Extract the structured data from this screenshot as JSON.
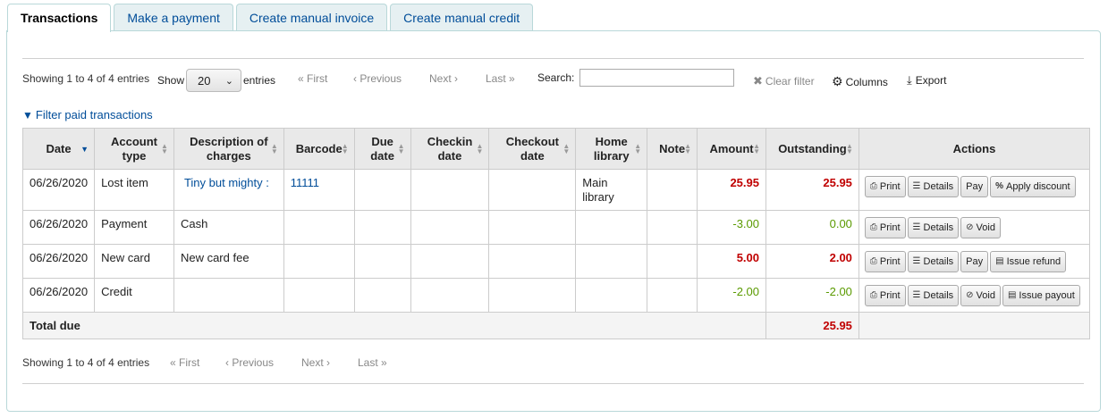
{
  "tabs": [
    {
      "label": "Transactions",
      "active": true
    },
    {
      "label": "Make a payment"
    },
    {
      "label": "Create manual invoice"
    },
    {
      "label": "Create manual credit"
    }
  ],
  "top_pager": {
    "info": "Showing 1 to 4 of 4 entries",
    "show_label": "Show",
    "page_size": "20",
    "entries_label": "entries",
    "first": "First",
    "previous": "Previous",
    "next": "Next",
    "last": "Last",
    "search_label": "Search:",
    "search_value": "",
    "clear_filter": "Clear filter",
    "columns": "Columns",
    "export": "Export"
  },
  "filter_link": "Filter paid transactions",
  "table": {
    "headers": {
      "date": "Date",
      "account_type": "Account type",
      "description": "Description of charges",
      "barcode": "Barcode",
      "due_date": "Due date",
      "checkin_date": "Checkin date",
      "checkout_date": "Checkout date",
      "home_library": "Home library",
      "note": "Note",
      "amount": "Amount",
      "outstanding": "Outstanding",
      "actions": "Actions"
    },
    "rows": [
      {
        "date": "06/26/2020",
        "type": "Lost item",
        "desc": "Tiny but mighty :",
        "barcode": "11111",
        "home_library": "Main library",
        "amount": "25.95",
        "outstanding": "25.95"
      },
      {
        "date": "06/26/2020",
        "type": "Payment",
        "desc": "Cash",
        "barcode": "",
        "home_library": "",
        "amount": "-3.00",
        "outstanding": "0.00"
      },
      {
        "date": "06/26/2020",
        "type": "New card",
        "desc": "New card fee",
        "barcode": "",
        "home_library": "",
        "amount": "5.00",
        "outstanding": "2.00"
      },
      {
        "date": "06/26/2020",
        "type": "Credit",
        "desc": "",
        "barcode": "",
        "home_library": "",
        "amount": "-2.00",
        "outstanding": "-2.00"
      }
    ],
    "total_label": "Total due",
    "total_value": "25.95"
  },
  "buttons": {
    "print": "Print",
    "details": "Details",
    "pay": "Pay",
    "void": "Void",
    "apply_discount": "Apply discount",
    "issue_refund": "Issue refund",
    "issue_payout": "Issue payout"
  },
  "bottom_pager": {
    "info": "Showing 1 to 4 of 4 entries",
    "first": "First",
    "previous": "Previous",
    "next": "Next",
    "last": "Last"
  },
  "icons": {
    "print": "printer-icon",
    "details": "list-icon",
    "void": "ban-icon",
    "discount": "percent-icon",
    "refund": "money-icon",
    "payout": "money-icon",
    "columns": "gear-icon",
    "export": "download-icon",
    "clear": "close-icon",
    "filter": "filter-icon"
  },
  "colors": {
    "link": "#004d99",
    "positive_amount": "#c00000",
    "negative_amount": "#5a9a00",
    "tab_bg": "#e6f0f2",
    "header_bg": "#e9e9e9"
  }
}
